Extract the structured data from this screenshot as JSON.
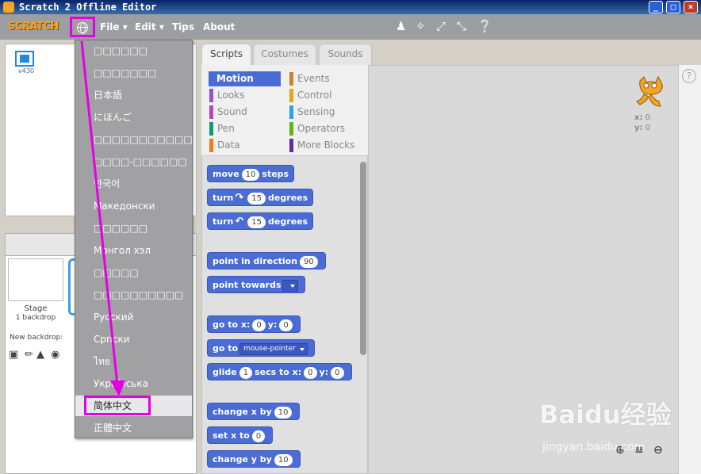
{
  "window": {
    "title": "Scratch 2 Offline Editor",
    "minimize_glyph": "_",
    "maximize_glyph": "□",
    "close_glyph": "×"
  },
  "menubar": {
    "logo_text": "SCRATCH",
    "menus": [
      "File ▾",
      "Edit ▾",
      "Tips",
      "About"
    ],
    "tool_icons": [
      "duplicate-icon",
      "cut-icon",
      "grow-icon",
      "shrink-icon",
      "help-icon"
    ]
  },
  "stage": {
    "version": "v430"
  },
  "language_menu": {
    "items": [
      "□□□□□□",
      "□□□□□□□",
      "日本語",
      "にほんご",
      "□□□□□□□□□□□",
      "□□□□-□□□□□□",
      "한국어",
      "Македонски",
      "□□□□□□",
      "Монгол хэл",
      "□□□□□",
      "□□□□□□□□□□",
      "Русский",
      "Српски",
      "ไทย",
      "Українська",
      "简体中文",
      "正體中文"
    ],
    "hovered_index": 16
  },
  "sprites_panel": {
    "stage_label": "Stage",
    "backdrop_count": "1 backdrop",
    "new_backdrop_label": "New backdrop:"
  },
  "tabs": [
    "Scripts",
    "Costumes",
    "Sounds"
  ],
  "categories": [
    {
      "label": "Motion",
      "color": "#4a6cd4",
      "selected": true
    },
    {
      "label": "Looks",
      "color": "#8a55d7"
    },
    {
      "label": "Sound",
      "color": "#bb42c3"
    },
    {
      "label": "Pen",
      "color": "#0e9a6c"
    },
    {
      "label": "Data",
      "color": "#ee7d16"
    },
    {
      "label": "Events",
      "color": "#c88330"
    },
    {
      "label": "Control",
      "color": "#e1a91a"
    },
    {
      "label": "Sensing",
      "color": "#2ca5e2"
    },
    {
      "label": "Operators",
      "color": "#5cb712"
    },
    {
      "label": "More Blocks",
      "color": "#632d99"
    }
  ],
  "blocks": {
    "move": {
      "a": "move",
      "n": "10",
      "b": "steps"
    },
    "turn_right": {
      "a": "turn",
      "rot": "↷",
      "n": "15",
      "b": "degrees"
    },
    "turn_left": {
      "a": "turn",
      "rot": "↶",
      "n": "15",
      "b": "degrees"
    },
    "point_dir": {
      "a": "point in direction",
      "n": "90"
    },
    "point_towards": {
      "a": "point towards",
      "drop": ""
    },
    "go_to_xy": {
      "a": "go to x:",
      "x": "0",
      "b": "y:",
      "y": "0"
    },
    "go_to": {
      "a": "go to",
      "drop": "mouse-pointer"
    },
    "glide": {
      "a": "glide",
      "n": "1",
      "b": "secs to x:",
      "x": "0",
      "c": "y:",
      "y": "0"
    },
    "change_x": {
      "a": "change x by",
      "n": "10"
    },
    "set_x": {
      "a": "set x to",
      "n": "0"
    },
    "change_y": {
      "a": "change y by",
      "n": "10"
    }
  },
  "script_area": {
    "x_label": "x:",
    "x_value": "0",
    "y_label": "y:",
    "y_value": "0",
    "help_glyph": "?"
  },
  "watermark": {
    "main": "Baidu经验",
    "sub": "jingyan.baidu.com"
  }
}
